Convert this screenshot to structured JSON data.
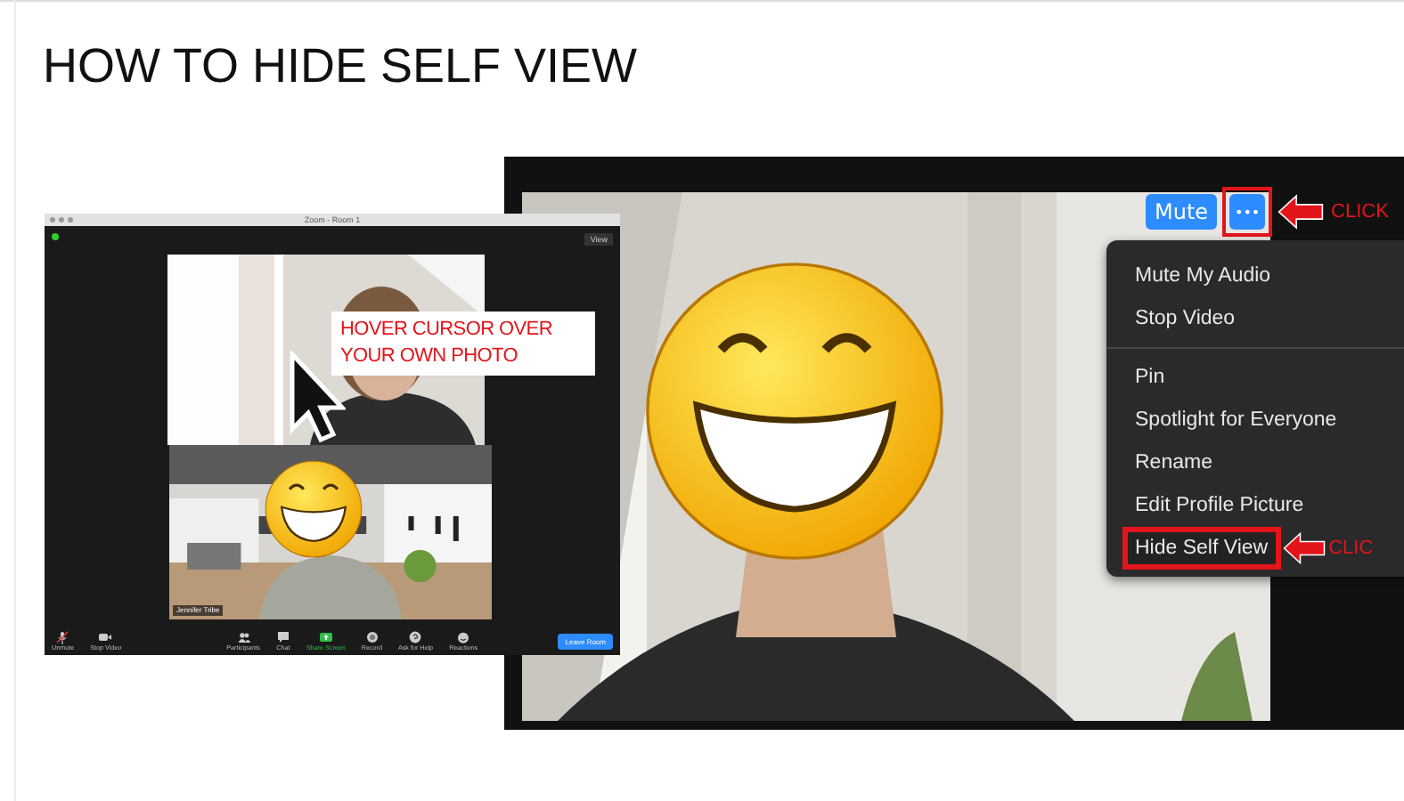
{
  "slide": {
    "title": "HOW TO HIDE SELF VIEW"
  },
  "left_screenshot": {
    "window_title": "Zoom - Room 1",
    "view_button": "View",
    "callout": "HOVER CURSOR OVER YOUR OWN PHOTO",
    "name_tag": "Jennifer Tribe",
    "toolbar": [
      {
        "label": "Unmute",
        "kind": "mic"
      },
      {
        "label": "Stop Video",
        "kind": "camera"
      },
      {
        "label": "Participants",
        "kind": "people"
      },
      {
        "label": "Chat",
        "kind": "chat"
      },
      {
        "label": "Share Screen",
        "kind": "share"
      },
      {
        "label": "Record",
        "kind": "record"
      },
      {
        "label": "Ask for Help",
        "kind": "help"
      },
      {
        "label": "Reactions",
        "kind": "reactions"
      }
    ],
    "leave_button": "Leave Room"
  },
  "right_screenshot": {
    "mute_button": "Mute",
    "more_button": "•••",
    "more_annotation": "CLICK",
    "menu_groups": [
      [
        {
          "label": "Mute My Audio",
          "highlighted": false
        },
        {
          "label": "Stop Video",
          "highlighted": false
        }
      ],
      [
        {
          "label": "Pin",
          "highlighted": false
        },
        {
          "label": "Spotlight for Everyone",
          "highlighted": false
        },
        {
          "label": "Rename",
          "highlighted": false
        },
        {
          "label": "Edit Profile Picture",
          "highlighted": false
        },
        {
          "label": "Hide Self View",
          "highlighted": true
        }
      ]
    ],
    "menu_annotation": "CLIC"
  }
}
